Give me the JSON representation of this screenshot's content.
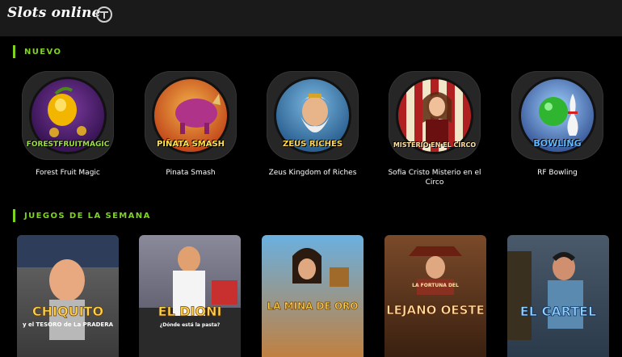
{
  "header": {
    "title": "Slots online"
  },
  "sections": [
    {
      "title": "NUEVO"
    },
    {
      "title": "JUEGOS DE LA SEMANA"
    }
  ],
  "nuevo_games": [
    {
      "name": "Forest Fruit Magic",
      "logo": "FORESTFRUITMAGIC"
    },
    {
      "name": "Pinata Smash",
      "logo": "PIÑATA SMASH"
    },
    {
      "name": "Zeus Kingdom of Riches",
      "logo": "ZEUS RICHES"
    },
    {
      "name": "Sofia Cristo Misterio en el Circo",
      "logo": "MISTERIO EN EL CIRCO"
    },
    {
      "name": "RF Bowling",
      "logo": "BOWLING"
    }
  ],
  "semana_games": [
    {
      "logo": "CHIQUITO",
      "sub": "y el TESORO de La PRADERA"
    },
    {
      "logo": "EL DIONI",
      "sub": "¿Dónde está la pasta?"
    },
    {
      "logo": "LA MINA DE ORO",
      "sub": ""
    },
    {
      "logo": "LEJANO OESTE",
      "sub": "LA FORTUNA DEL"
    },
    {
      "logo": "EL CARTEL",
      "sub": ""
    }
  ],
  "colors": {
    "accent": "#7ed321",
    "header_bg": "#1a1a1a",
    "tile_bg": "#262626"
  }
}
